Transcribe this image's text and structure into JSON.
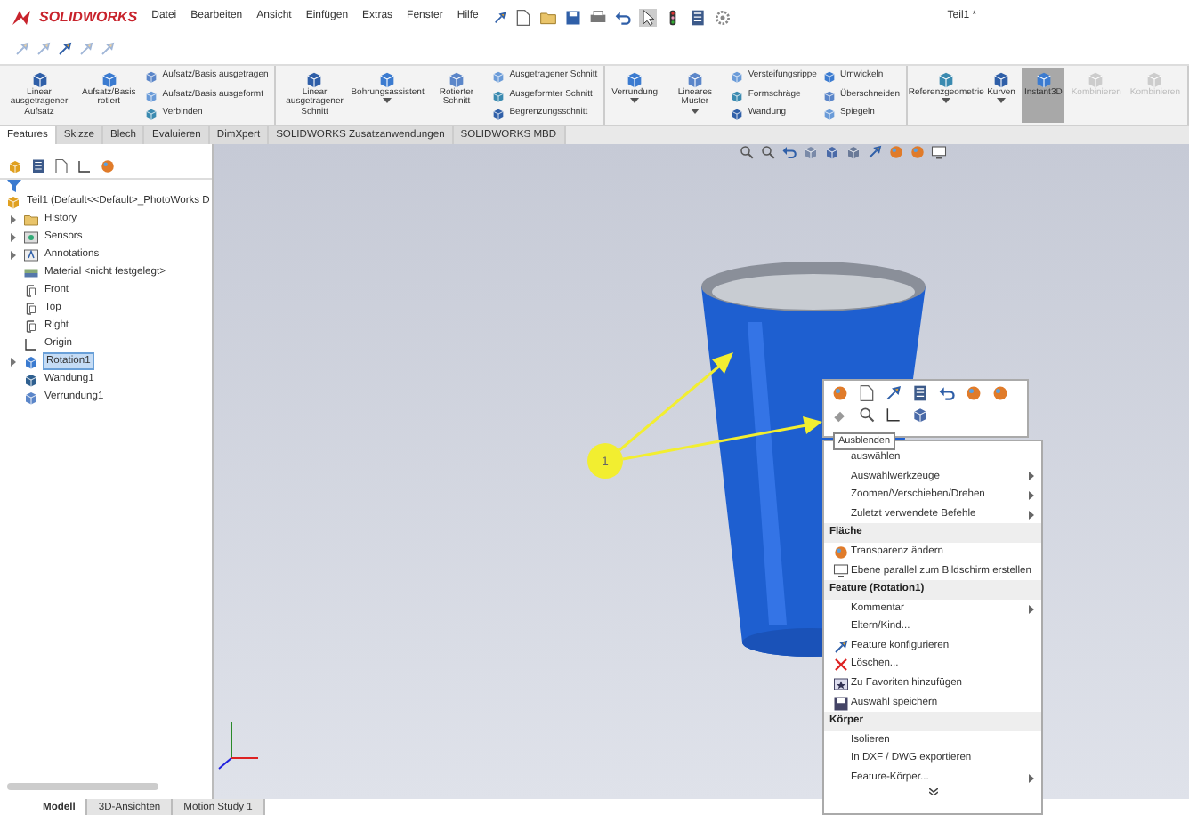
{
  "app": {
    "logo": "SOLIDWORKS",
    "menu": [
      "Datei",
      "Bearbeiten",
      "Ansicht",
      "Einfügen",
      "Extras",
      "Fenster",
      "Hilfe"
    ],
    "title": "Teil1 *"
  },
  "ribbon": {
    "groups": [
      {
        "columns": [
          {
            "kind": "large",
            "label": "Linear ausgetragener Aufsatz",
            "dropdown": false
          },
          {
            "kind": "large",
            "label": "Aufsatz/Basis rotiert",
            "dropdown": false
          },
          {
            "kind": "stack",
            "items": [
              "Aufsatz/Basis ausgetragen",
              "Aufsatz/Basis ausgeformt",
              "Verbinden"
            ]
          }
        ]
      },
      {
        "columns": [
          {
            "kind": "large",
            "label": "Linear ausgetragener Schnitt",
            "dropdown": false
          },
          {
            "kind": "large",
            "label": "Bohrungsassistent",
            "dropdown": true
          },
          {
            "kind": "large",
            "label": "Rotierter Schnitt",
            "dropdown": false
          },
          {
            "kind": "stack",
            "items": [
              "Ausgetragener Schnitt",
              "Ausgeformter Schnitt",
              "Begrenzungsschnitt"
            ]
          }
        ]
      },
      {
        "columns": [
          {
            "kind": "large",
            "label": "Verrundung",
            "dropdown": true
          },
          {
            "kind": "large",
            "label": "Lineares Muster",
            "dropdown": true
          },
          {
            "kind": "stack",
            "items": [
              "Versteifungsrippe",
              "Formschräge",
              "Wandung"
            ]
          },
          {
            "kind": "stack",
            "items": [
              "Umwickeln",
              "Überschneiden",
              "Spiegeln"
            ]
          }
        ]
      },
      {
        "columns": [
          {
            "kind": "large",
            "label": "Referenzgeometrie",
            "dropdown": true
          },
          {
            "kind": "large",
            "label": "Kurven",
            "dropdown": true
          },
          {
            "kind": "toggle",
            "label": "Instant3D",
            "selected": true,
            "disabled": false
          },
          {
            "kind": "toggle",
            "label": "Kombinieren",
            "selected": false,
            "disabled": true
          },
          {
            "kind": "toggle",
            "label": "Kombinieren",
            "selected": false,
            "disabled": true
          }
        ]
      }
    ]
  },
  "tabs": [
    {
      "label": "Features",
      "selected": true
    },
    {
      "label": "Skizze",
      "selected": false
    },
    {
      "label": "Blech",
      "selected": false
    },
    {
      "label": "Evaluieren",
      "selected": false
    },
    {
      "label": "DimXpert",
      "selected": false
    },
    {
      "label": "SOLIDWORKS Zusatzanwendungen",
      "selected": false
    },
    {
      "label": "SOLIDWORKS MBD",
      "selected": false
    }
  ],
  "tree": {
    "root": {
      "label": "Teil1 (Default<<Default>_PhotoWorks D",
      "children": [
        {
          "label": "History",
          "kind": "folder",
          "expanded": false,
          "selected": false
        },
        {
          "label": "Sensors",
          "kind": "sensor",
          "expanded": false,
          "selected": false
        },
        {
          "label": "Annotations",
          "kind": "annotation",
          "expanded": false,
          "selected": false
        },
        {
          "label": "Material <nicht festgelegt>",
          "kind": "material",
          "selected": false
        },
        {
          "label": "Front",
          "kind": "plane",
          "selected": false
        },
        {
          "label": "Top",
          "kind": "plane",
          "selected": false
        },
        {
          "label": "Right",
          "kind": "plane",
          "selected": false
        },
        {
          "label": "Origin",
          "kind": "origin",
          "selected": false
        },
        {
          "label": "Rotation1",
          "kind": "revolve",
          "expanded": false,
          "selected": true
        },
        {
          "label": "Wandung1",
          "kind": "shell",
          "selected": false
        },
        {
          "label": "Verrundung1",
          "kind": "fillet",
          "selected": false
        }
      ]
    }
  },
  "viewport": {
    "callout": "1",
    "tooltip": "Ausblenden"
  },
  "context_menu": {
    "items": [
      {
        "kind": "command",
        "label": "auswählen",
        "submenu": false,
        "has_icon": false
      },
      {
        "kind": "command",
        "label": "Auswahlwerkzeuge",
        "submenu": true,
        "has_icon": false
      },
      {
        "kind": "command",
        "label": "Zoomen/Verschieben/Drehen",
        "submenu": true,
        "has_icon": false
      },
      {
        "kind": "command",
        "label": "Zuletzt verwendete Befehle",
        "submenu": true,
        "has_icon": false
      },
      {
        "kind": "header",
        "label": "Fläche"
      },
      {
        "kind": "command",
        "label": "Transparenz ändern",
        "submenu": false,
        "has_icon": true
      },
      {
        "kind": "command",
        "label": "Ebene parallel zum Bildschirm erstellen",
        "submenu": false,
        "has_icon": true
      },
      {
        "kind": "header",
        "label": "Feature (Rotation1)"
      },
      {
        "kind": "command",
        "label": "Kommentar",
        "submenu": true,
        "has_icon": false
      },
      {
        "kind": "command",
        "label": "Eltern/Kind...",
        "submenu": false,
        "has_icon": false
      },
      {
        "kind": "command",
        "label": "Feature konfigurieren",
        "submenu": false,
        "has_icon": true
      },
      {
        "kind": "command",
        "label": "Löschen...",
        "submenu": false,
        "has_icon": true
      },
      {
        "kind": "command",
        "label": "Zu Favoriten hinzufügen",
        "submenu": false,
        "has_icon": true
      },
      {
        "kind": "command",
        "label": "Auswahl speichern",
        "submenu": false,
        "has_icon": true
      },
      {
        "kind": "header",
        "label": "Körper"
      },
      {
        "kind": "command",
        "label": "Isolieren",
        "submenu": false,
        "has_icon": false
      },
      {
        "kind": "command",
        "label": "In DXF / DWG exportieren",
        "submenu": false,
        "has_icon": false
      },
      {
        "kind": "command",
        "label": "Feature-Körper...",
        "submenu": true,
        "has_icon": false
      }
    ]
  },
  "bottom_tabs": [
    {
      "label": "Modell",
      "selected": true
    },
    {
      "label": "3D-Ansichten",
      "selected": false
    },
    {
      "label": "Motion Study 1",
      "selected": false
    }
  ]
}
